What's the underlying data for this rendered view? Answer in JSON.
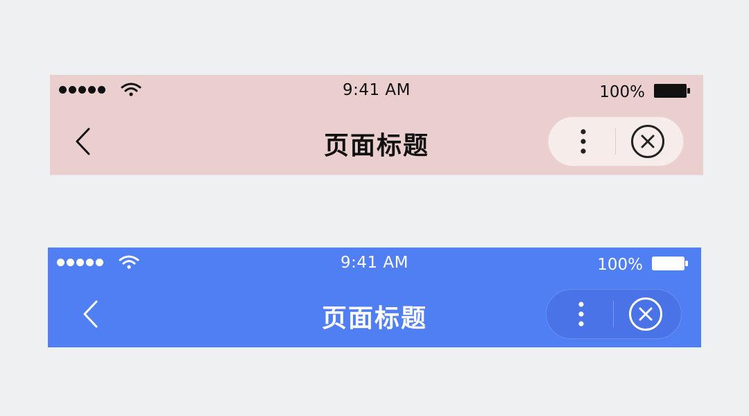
{
  "bars": [
    {
      "theme": "light",
      "background": "#ebcfcf",
      "foreground": "#111111",
      "status": {
        "signal_dots": 5,
        "signal_icon": "cellular-signal-dots",
        "wifi_icon": "wifi-icon",
        "time": "9:41 AM",
        "battery_percent": "100%",
        "battery_icon": "battery-full-icon"
      },
      "nav": {
        "back_icon": "chevron-left-icon",
        "title": "页面标题",
        "more_icon": "more-vertical-icon",
        "close_icon": "close-circle-icon"
      }
    },
    {
      "theme": "dark",
      "background": "#507ef3",
      "foreground": "#ffffff",
      "status": {
        "signal_dots": 5,
        "signal_icon": "cellular-signal-dots",
        "wifi_icon": "wifi-icon",
        "time": "9:41 AM",
        "battery_percent": "100%",
        "battery_icon": "battery-full-icon"
      },
      "nav": {
        "back_icon": "chevron-left-icon",
        "title": "页面标题",
        "more_icon": "more-vertical-icon",
        "close_icon": "close-circle-icon"
      }
    }
  ]
}
